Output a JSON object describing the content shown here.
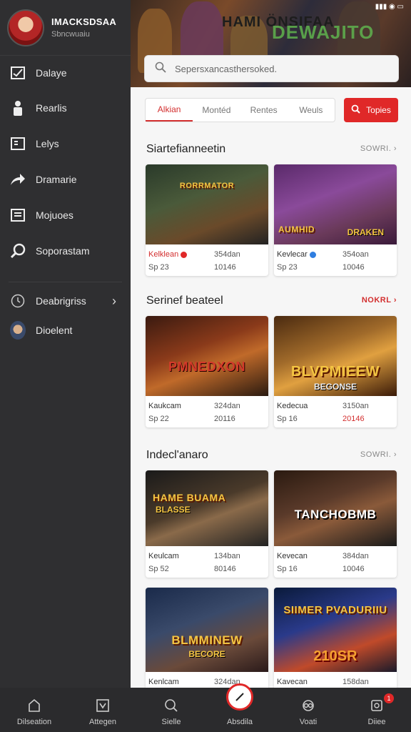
{
  "profile": {
    "name": "IMACKSDSAA",
    "subtitle": "Sbncwuaiu"
  },
  "sidebar": {
    "items": [
      {
        "label": "Dalaye",
        "icon": "message-icon"
      },
      {
        "label": "Rearlis",
        "icon": "person-icon"
      },
      {
        "label": "Lelys",
        "icon": "document-icon"
      },
      {
        "label": "Dramarie",
        "icon": "share-icon"
      },
      {
        "label": "Mojuoes",
        "icon": "list-icon"
      },
      {
        "label": "Soporastam",
        "icon": "search-icon"
      }
    ],
    "bottom_items": [
      {
        "label": "Deabrigriss",
        "icon": "clock-icon"
      },
      {
        "label": "Dioelent",
        "icon": "avatar"
      }
    ]
  },
  "hero": {
    "title": "HAMI ÖNSIFAA",
    "title_overlay": "DEWAJITO",
    "status": "▮▮▮ ◉ ▭"
  },
  "search": {
    "placeholder": "Sepersxancasthersoked."
  },
  "filters": {
    "tabs": [
      "Alkian",
      "Montéd",
      "Rentes",
      "Weuls"
    ],
    "active": "Alkian",
    "topics_label": "Topies"
  },
  "sections": [
    {
      "title": "Siartefianneetin",
      "link": "SOWRI.",
      "link_style": "gray",
      "cards": [
        {
          "thumb_title": "RORRMATOR",
          "thumb_sub": "",
          "author": "Kelklean",
          "author_badge": "red",
          "date": "Sp 23",
          "views": "354dan",
          "count": "10146"
        },
        {
          "thumb_title": "AUMHID",
          "thumb_sub": "DRAKEN",
          "author": "Kevlecar",
          "author_badge": "blue",
          "date": "Sp 23",
          "views": "354oan",
          "count": "10046"
        }
      ]
    },
    {
      "title": "Serinef beateel",
      "link": "NOKRL",
      "link_style": "red",
      "cards": [
        {
          "thumb_title": "PMNEDXON",
          "thumb_sub": "",
          "author": "Kaukcam",
          "author_badge": "",
          "date": "Sp 22",
          "views": "324dan",
          "count": "20116"
        },
        {
          "thumb_title": "BLVPMIEEW",
          "thumb_sub": "BEGONSE",
          "author": "Kedecua",
          "author_badge": "",
          "date": "Sp 16",
          "views": "3150an",
          "count": "20146"
        }
      ]
    },
    {
      "title": "Indecl'anaro",
      "link": "SOWRI.",
      "link_style": "gray",
      "cards": [
        {
          "thumb_title": "HAME BUAMA",
          "thumb_sub": "BLASSE",
          "author": "Keulcam",
          "author_badge": "",
          "date": "Sp 52",
          "views": "134ban",
          "count": "80146"
        },
        {
          "thumb_title": "TANCHOBMB",
          "thumb_sub": "",
          "author": "Kevecan",
          "author_badge": "",
          "date": "Sp 16",
          "views": "384dan",
          "count": "10046"
        },
        {
          "thumb_title": "BLMMINEW",
          "thumb_sub": "BECORE",
          "author": "Kenlcam",
          "author_badge": "",
          "date": "",
          "views": "324dan",
          "count": ""
        },
        {
          "thumb_title": "SIIMER PVADURIIU",
          "thumb_sub": "210SR",
          "author": "Kavecan",
          "author_badge": "",
          "date": "",
          "views": "158dan",
          "count": ""
        }
      ]
    }
  ],
  "bottom_nav": [
    {
      "label": "Dilseation",
      "icon": "home-icon"
    },
    {
      "label": "Attegen",
      "icon": "shield-icon"
    },
    {
      "label": "Sielle",
      "icon": "search-icon"
    },
    {
      "label": "Absdila",
      "icon": "compass-icon"
    },
    {
      "label": "Voati",
      "icon": "eye-icon"
    },
    {
      "label": "Diiee",
      "icon": "notification-icon",
      "badge": "1"
    }
  ],
  "colors": {
    "accent": "#e02828",
    "sidebar_bg": "#2f2f31",
    "content_bg": "#f6f6f6"
  }
}
